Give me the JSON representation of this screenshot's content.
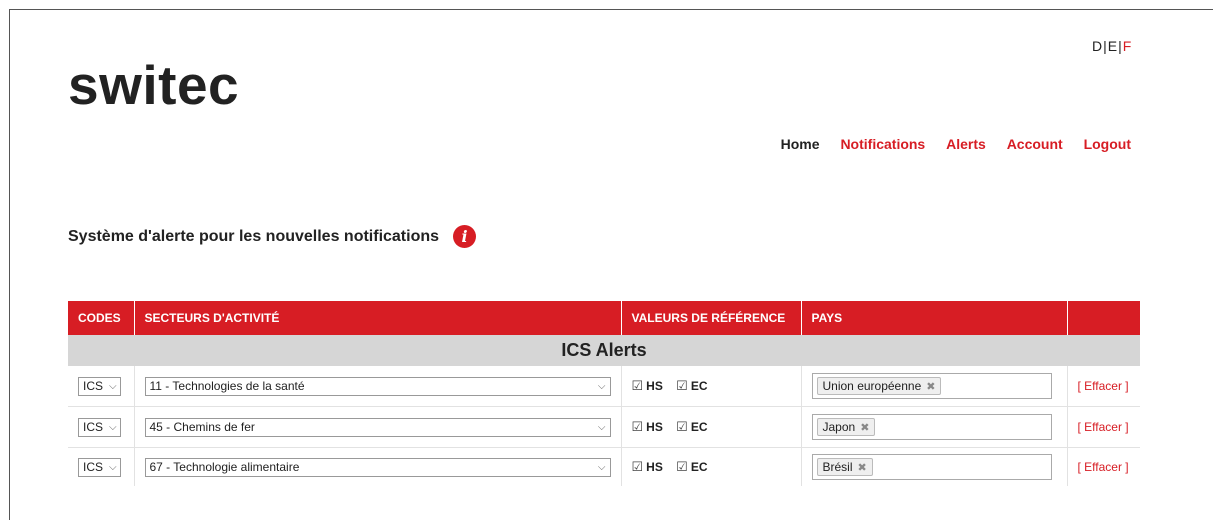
{
  "brand": {
    "logo": "switec"
  },
  "languages": [
    {
      "code": "D",
      "active": false
    },
    {
      "code": "E",
      "active": false
    },
    {
      "code": "F",
      "active": true
    }
  ],
  "nav": {
    "home": "Home",
    "notifications": "Notifications",
    "alerts": "Alerts",
    "account": "Account",
    "logout": "Logout"
  },
  "page": {
    "title": "Système d'alerte pour les nouvelles notifications",
    "info_icon_glyph": "i"
  },
  "table": {
    "headers": [
      "CODES",
      "SECTEURS D'ACTIVITÉ",
      "VALEURS DE RÉFÉRENCE",
      "PAYS",
      ""
    ],
    "group_label": "ICS Alerts",
    "rows": [
      {
        "code": "ICS",
        "sector": "11 - Technologies de la santé",
        "hs": "HS",
        "ec": "EC",
        "country": "Union européenne",
        "clear": "[ Effacer ]"
      },
      {
        "code": "ICS",
        "sector": "45 - Chemins de fer",
        "hs": "HS",
        "ec": "EC",
        "country": "Japon",
        "clear": "[ Effacer ]"
      },
      {
        "code": "ICS",
        "sector": "67 - Technologie alimentaire",
        "hs": "HS",
        "ec": "EC",
        "country": "Brésil",
        "clear": "[ Effacer ]"
      }
    ]
  },
  "colors": {
    "accent": "#d71d24",
    "group_bg": "#d6d6d6"
  }
}
